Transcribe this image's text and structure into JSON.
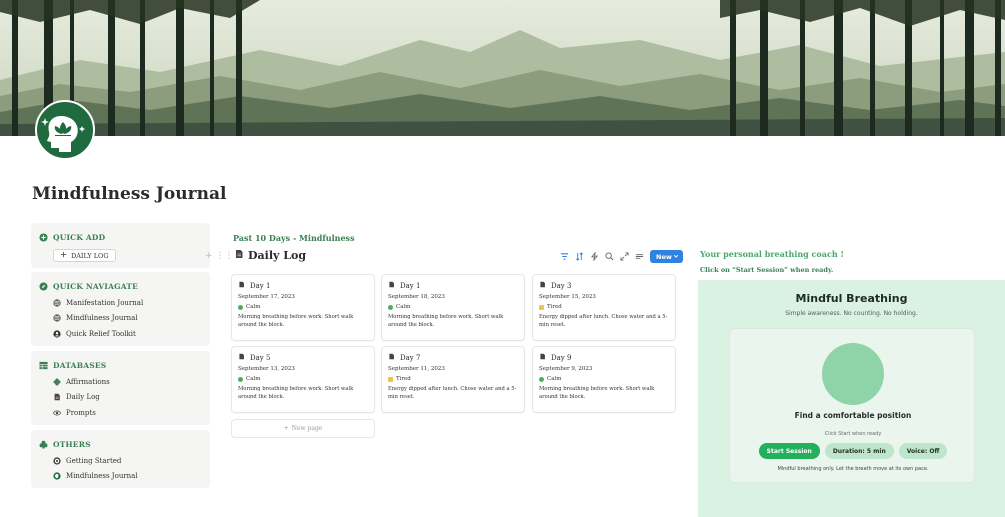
{
  "page": {
    "title": "Mindfulness Journal"
  },
  "colors": {
    "accent_green": "#3a7f53",
    "brand_dark_green": "#1f6a3e",
    "primary_blue": "#2e82e0",
    "panel_green": "#daf2e2",
    "calm": "#4cae5b",
    "tired": "#f2c14e"
  },
  "sidebar": {
    "quick_add": {
      "heading": "QUICK ADD",
      "icon": "plus-chat-icon",
      "button_label": "DAILY LOG"
    },
    "quick_navigate": {
      "heading": "QUICK NAVIAGATE",
      "icon": "compass-icon",
      "items": [
        {
          "label": "Manifestation Journal",
          "icon": "globe-icon"
        },
        {
          "label": "Mindfulness Journal",
          "icon": "globe-icon"
        },
        {
          "label": "Quick Relief Toolkit",
          "icon": "person-icon"
        }
      ]
    },
    "databases": {
      "heading": "DATABASES",
      "icon": "table-icon",
      "items": [
        {
          "label": "Affirmations",
          "icon": "clover-icon"
        },
        {
          "label": "Daily Log",
          "icon": "document-icon"
        },
        {
          "label": "Prompts",
          "icon": "eye-icon"
        }
      ]
    },
    "others": {
      "heading": "OTHERS",
      "icon": "club-icon",
      "items": [
        {
          "label": "Getting Started",
          "icon": "target-icon"
        },
        {
          "label": "Mindfulness Journal",
          "icon": "head-icon"
        }
      ]
    }
  },
  "center": {
    "section_label": "Past 10 Days - Mindfulness",
    "database_title": "Daily Log",
    "new_button": "New",
    "new_page": "New page",
    "cards": [
      {
        "title": "Day 1",
        "date": "September 17, 2023",
        "mood": "Calm",
        "note": "Morning breathing before work. Short walk around the block."
      },
      {
        "title": "Day 1",
        "date": "September 18, 2023",
        "mood": "Calm",
        "note": "Morning breathing before work. Short walk around the block."
      },
      {
        "title": "Day 3",
        "date": "September 15, 2023",
        "mood": "Tired",
        "note": "Energy dipped after lunch. Chose water and a 5-min reset."
      },
      {
        "title": "Day 5",
        "date": "September 13, 2023",
        "mood": "Calm",
        "note": "Morning breathing before work. Short walk around the block."
      },
      {
        "title": "Day 7",
        "date": "September 11, 2023",
        "mood": "Tired",
        "note": "Energy dipped after lunch. Chose water and a 5-min reset."
      },
      {
        "title": "Day 9",
        "date": "September 9, 2023",
        "mood": "Calm",
        "note": "Morning breathing before work. Short walk around the block."
      }
    ]
  },
  "coach": {
    "title": "Your personal breathing coach !",
    "subtitle": "Click on “Start Session” when ready.",
    "widget": {
      "title": "Mindful Breathing",
      "subtitle": "Simple awareness. No counting. No holding.",
      "position_text": "Find a comfortable position",
      "hint": "Click Start when ready",
      "start_button": "Start Session",
      "duration_button": "Duration: 5 min",
      "voice_button": "Voice: Off",
      "footer": "Mindful breathing only. Let the breath move at its own pace."
    }
  }
}
